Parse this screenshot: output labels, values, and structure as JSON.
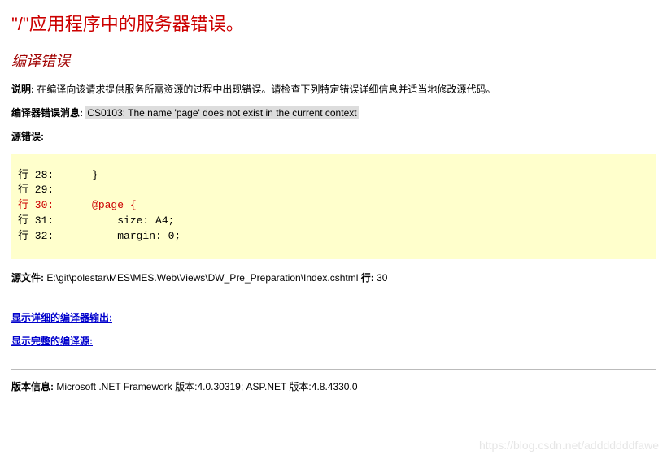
{
  "title": "\"/\"应用程序中的服务器错误。",
  "subtitle": "编译错误",
  "description_label": "说明:",
  "description_text": " 在编译向该请求提供服务所需资源的过程中出现错误。请检查下列特定错误详细信息并适当地修改源代码。",
  "compiler_label": "编译器错误消息: ",
  "compiler_message": "CS0103: The name 'page' does not exist in the current context",
  "source_error_label": "源错误:",
  "code_lines": [
    {
      "text": "行 28:      }",
      "error": false
    },
    {
      "text": "行 29:",
      "error": false
    },
    {
      "text": "行 30:      @page {",
      "error": true
    },
    {
      "text": "行 31:          size: A4;",
      "error": false
    },
    {
      "text": "行 32:          margin: 0;",
      "error": false
    }
  ],
  "source_file_label": "源文件: ",
  "source_file_path": "E:\\git\\polestar\\MES\\MES.Web\\Views\\DW_Pre_Preparation\\Index.cshtml",
  "line_label": "    行: ",
  "line_number": "30",
  "link_detailed": "显示详细的编译器输出:",
  "link_full_source": "显示完整的编译源:",
  "version_label": "版本信息:",
  "version_text": " Microsoft .NET Framework 版本:4.0.30319; ASP.NET 版本:4.8.4330.0",
  "watermark": "https://blog.csdn.net/adddddddfawe"
}
